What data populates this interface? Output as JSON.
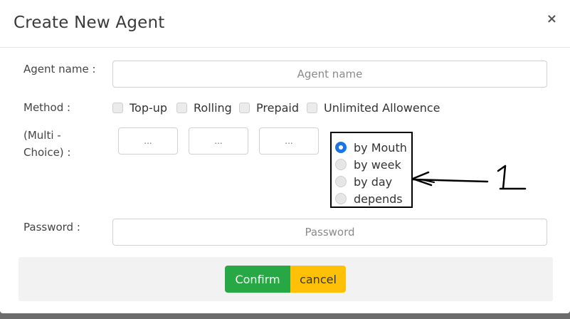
{
  "modal": {
    "title": "Create New Agent",
    "close_label": "×"
  },
  "form": {
    "agent_name": {
      "label": "Agent name :",
      "placeholder": "Agent name",
      "value": ""
    },
    "method": {
      "label": "Method :",
      "options": [
        {
          "label": "Top-up",
          "checked": false
        },
        {
          "label": "Rolling",
          "checked": false
        },
        {
          "label": "Prepaid",
          "checked": false
        },
        {
          "label": "Unlimited Allowence",
          "checked": false
        }
      ]
    },
    "multi_choice": {
      "label_line1": "(Multi -",
      "label_line2": "Choice) :",
      "inputs": [
        {
          "placeholder": "..."
        },
        {
          "placeholder": "..."
        },
        {
          "placeholder": "..."
        }
      ],
      "radios": [
        {
          "label": "by Mouth",
          "checked": true
        },
        {
          "label": "by week",
          "checked": false
        },
        {
          "label": "by day",
          "checked": false
        },
        {
          "label": "depends",
          "checked": false
        }
      ]
    },
    "password": {
      "label": "Password :",
      "placeholder": "Password",
      "value": ""
    }
  },
  "annotation": {
    "text": "1"
  },
  "footer": {
    "confirm_label": "Confirm",
    "cancel_label": "cancel"
  },
  "colors": {
    "confirm": "#28a745",
    "cancel": "#ffc107",
    "radio_checked": "#1a73e8",
    "footer_bg": "#f2f2f2"
  }
}
